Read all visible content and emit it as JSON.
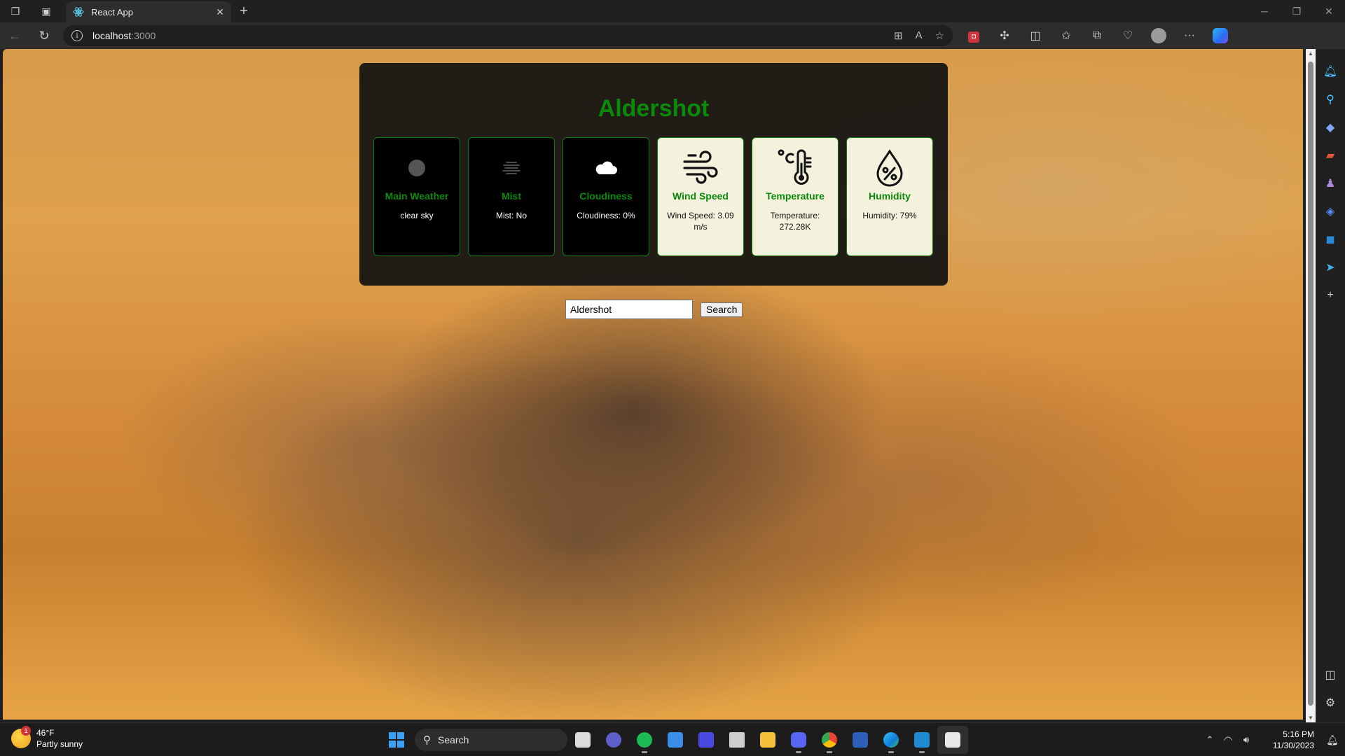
{
  "browser": {
    "tab_title": "React App",
    "new_tab_symbol": "+",
    "close_symbol": "✕",
    "url_host": "localhost",
    "url_port": ":3000",
    "info_symbol": "i"
  },
  "app": {
    "city": "Aldershot",
    "cards": [
      {
        "label": "Main Weather",
        "value": "clear sky",
        "theme": "dark",
        "icon": "dot-icon"
      },
      {
        "label": "Mist",
        "value": "Mist: No",
        "theme": "dark",
        "icon": "mist-icon"
      },
      {
        "label": "Cloudiness",
        "value": "Cloudiness: 0%",
        "theme": "dark",
        "icon": "cloud-icon"
      },
      {
        "label": "Wind Speed",
        "value": "Wind Speed: 3.09 m/s",
        "theme": "light",
        "icon": "wind-icon"
      },
      {
        "label": "Temperature",
        "value": "Temperature: 272.28K",
        "theme": "light",
        "icon": "thermometer-icon"
      },
      {
        "label": "Humidity",
        "value": "Humidity: 79%",
        "theme": "light",
        "icon": "humidity-drop-icon"
      }
    ],
    "search": {
      "value": "Aldershot",
      "button_label": "Search"
    }
  },
  "taskbar": {
    "weather_temp": "46°F",
    "weather_desc": "Partly sunny",
    "weather_badge": "1",
    "search_label": "Search",
    "time": "5:16 PM",
    "date": "11/30/2023"
  },
  "colors": {
    "accent_green": "#0a8a0a",
    "card_light": "#f4f2dc",
    "panel_bg": "#121212"
  }
}
